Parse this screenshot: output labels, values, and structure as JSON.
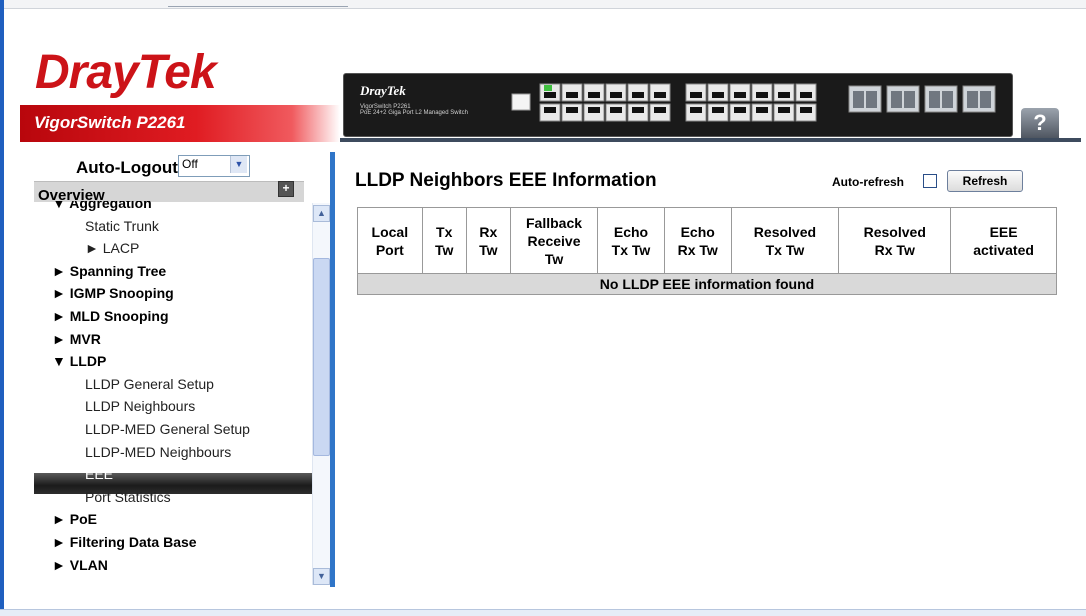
{
  "brand": {
    "logo": "DrayTek",
    "model": "VigorSwitch P2261"
  },
  "switch_image": {
    "brand": "DrayTek",
    "model": "VigorSwitch P2261\nPoE 24+2 Giga Port L2 Managed Switch"
  },
  "help": {
    "label": "?"
  },
  "sidebar": {
    "auto_logout_label": "Auto-Logout",
    "auto_logout_value": "Off",
    "overview_label": "Overview",
    "items": [
      {
        "label": "▼ Aggregation",
        "level": 1,
        "active": false
      },
      {
        "label": "Static Trunk",
        "level": 2,
        "active": false
      },
      {
        "label": "► LACP",
        "level": 2,
        "active": false
      },
      {
        "label": "► Spanning Tree",
        "level": 1,
        "active": false
      },
      {
        "label": "► IGMP Snooping",
        "level": 1,
        "active": false
      },
      {
        "label": "► MLD Snooping",
        "level": 1,
        "active": false
      },
      {
        "label": "► MVR",
        "level": 1,
        "active": false
      },
      {
        "label": "▼ LLDP",
        "level": 1,
        "active": false
      },
      {
        "label": "LLDP General Setup",
        "level": 2,
        "active": false
      },
      {
        "label": "LLDP Neighbours",
        "level": 2,
        "active": false
      },
      {
        "label": "LLDP-MED General Setup",
        "level": 2,
        "active": false
      },
      {
        "label": "LLDP-MED Neighbours",
        "level": 2,
        "active": false
      },
      {
        "label": "EEE",
        "level": 2,
        "active": true
      },
      {
        "label": "Port Statistics",
        "level": 2,
        "active": false
      },
      {
        "label": "► PoE",
        "level": 1,
        "active": false
      },
      {
        "label": "► Filtering Data Base",
        "level": 1,
        "active": false
      },
      {
        "label": "► VLAN",
        "level": 1,
        "active": false
      }
    ]
  },
  "main": {
    "title": "LLDP Neighbors EEE Information",
    "auto_refresh_label": "Auto-refresh",
    "auto_refresh_checked": false,
    "refresh_label": "Refresh",
    "table": {
      "columns": [
        "Local\nPort",
        "Tx\nTw",
        "Rx\nTw",
        "Fallback\nReceive\nTw",
        "Echo\nTx Tw",
        "Echo\nRx Tw",
        "Resolved\nTx Tw",
        "Resolved\nRx Tw",
        "EEE\nactivated"
      ],
      "empty_message": "No LLDP EEE information found"
    }
  },
  "colors": {
    "brand_red": "#cc1318",
    "divider_blue": "#2f75c8",
    "active_item_bg": "#1b1b1b",
    "empty_row_bg": "#d9d9d9"
  }
}
